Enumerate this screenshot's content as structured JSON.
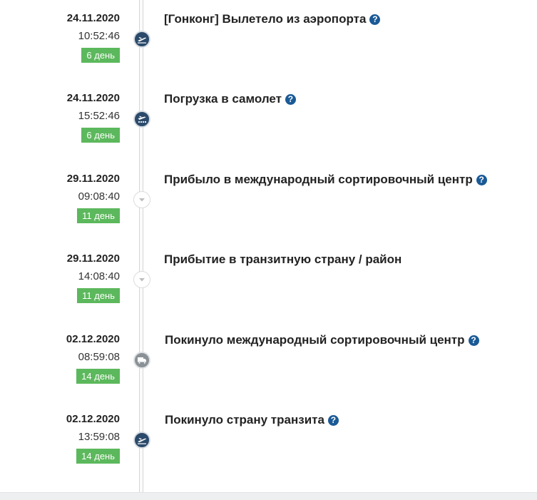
{
  "events": [
    {
      "date": "24.11.2020",
      "time": "10:52:46",
      "day": "6 день",
      "text": "[Гонконг] Вылетело из аэропорта",
      "icon": "airplane-takeoff-icon",
      "help": true
    },
    {
      "date": "24.11.2020",
      "time": "15:52:46",
      "day": "6 день",
      "text": "Погрузка в самолет",
      "icon": "airplane-loading-icon",
      "help": true
    },
    {
      "date": "29.11.2020",
      "time": "09:08:40",
      "day": "11 день",
      "text": "Прибыло в международный сортировочный центр",
      "icon": "chevron-down-icon",
      "help": true
    },
    {
      "date": "29.11.2020",
      "time": "14:08:40",
      "day": "11 день",
      "text": "Прибытие в транзитную страну / район",
      "icon": "chevron-down-icon",
      "help": false
    },
    {
      "date": "02.12.2020",
      "time": "08:59:08",
      "day": "14 день",
      "text": "Покинуло международный сортировочный центр",
      "icon": "truck-icon",
      "help": true
    },
    {
      "date": "02.12.2020",
      "time": "13:59:08",
      "day": "14 день",
      "text": "Покинуло страну транзита",
      "icon": "airplane-takeoff-icon",
      "help": true
    }
  ],
  "colors": {
    "day_badge": "#5cb85c",
    "help_icon": "#1a5a96",
    "node_dark": "#2b4a6b",
    "node_grey": "#8a9197"
  }
}
